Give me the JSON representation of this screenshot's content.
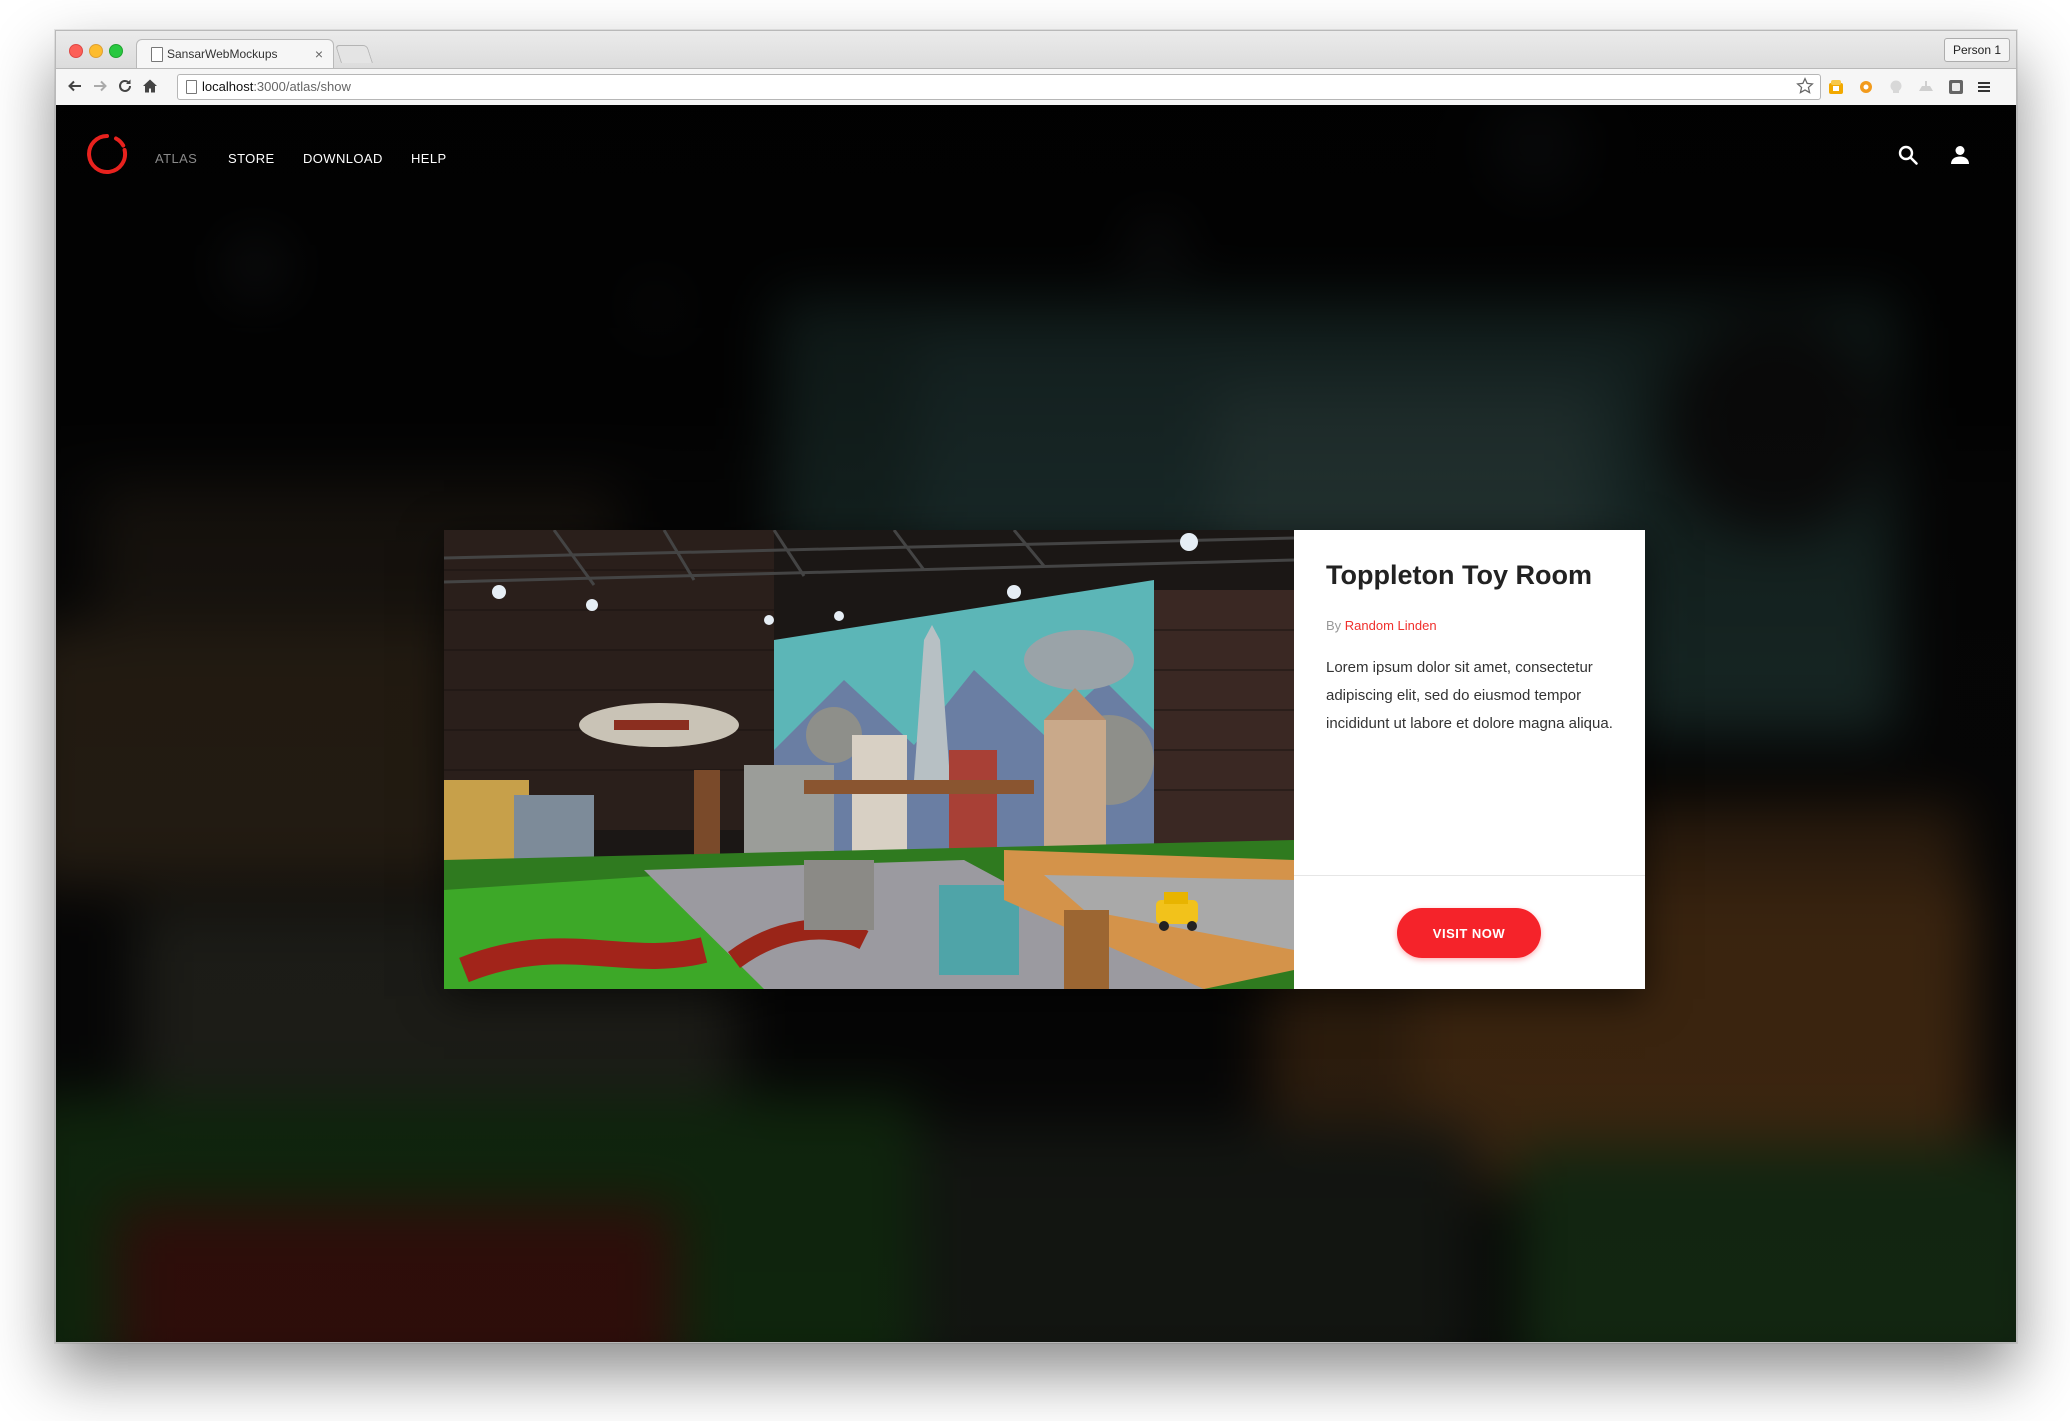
{
  "browser": {
    "tab_title": "SansarWebMockups",
    "tab_close": "×",
    "profile": "Person 1",
    "url_host": "localhost",
    "url_path": ":3000/atlas/show",
    "icons": [
      "back-icon",
      "forward-icon",
      "reload-icon",
      "home-icon",
      "page-icon",
      "bookmark-star-icon",
      "extension-icon",
      "menu-icon"
    ]
  },
  "site": {
    "logo": "sansar-logo",
    "nav": {
      "atlas": "ATLAS",
      "store": "STORE",
      "download": "DOWNLOAD",
      "help": "HELP"
    },
    "icons": [
      "search-icon",
      "account-icon"
    ]
  },
  "experience": {
    "title": "Toppleton Toy Room",
    "by_label": "By",
    "author": "Random Linden",
    "description": "Lorem ipsum dolor sit amet, consectetur adipiscing elit, sed do eiusmod tempor incididunt ut labore et dolore magna aliqua.",
    "cta": "VISIT NOW"
  },
  "colors": {
    "accent": "#f5232a",
    "author_link": "#f0302c",
    "nav_active": "#8a8a8a"
  }
}
